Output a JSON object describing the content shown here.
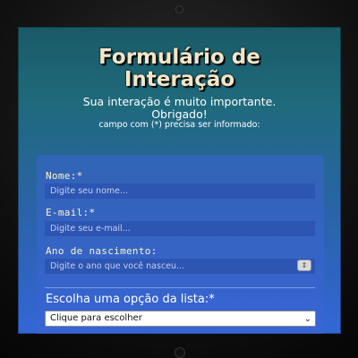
{
  "form": {
    "title_line1": "Formulário de",
    "title_line2": "Interação",
    "subtitle_line1": "Sua interação é muito importante.",
    "subtitle_line2": "Obrigado!",
    "required_note": "campo com (*) precisa ser informado:",
    "fields": [
      {
        "label": "Nome:*",
        "placeholder": "Digite seu nome..."
      },
      {
        "label": "E-mail:*",
        "placeholder": "Digite seu e-mail..."
      },
      {
        "label": "Ano de nascimento:",
        "placeholder": "Digite o ano que você nasceu..."
      }
    ],
    "list_label": "Escolha uma opção da lista:*",
    "select_value": "Clique para escolher",
    "icons": {
      "stepper": "spin-stepper-icon",
      "select": "chevron-down-icon"
    }
  }
}
